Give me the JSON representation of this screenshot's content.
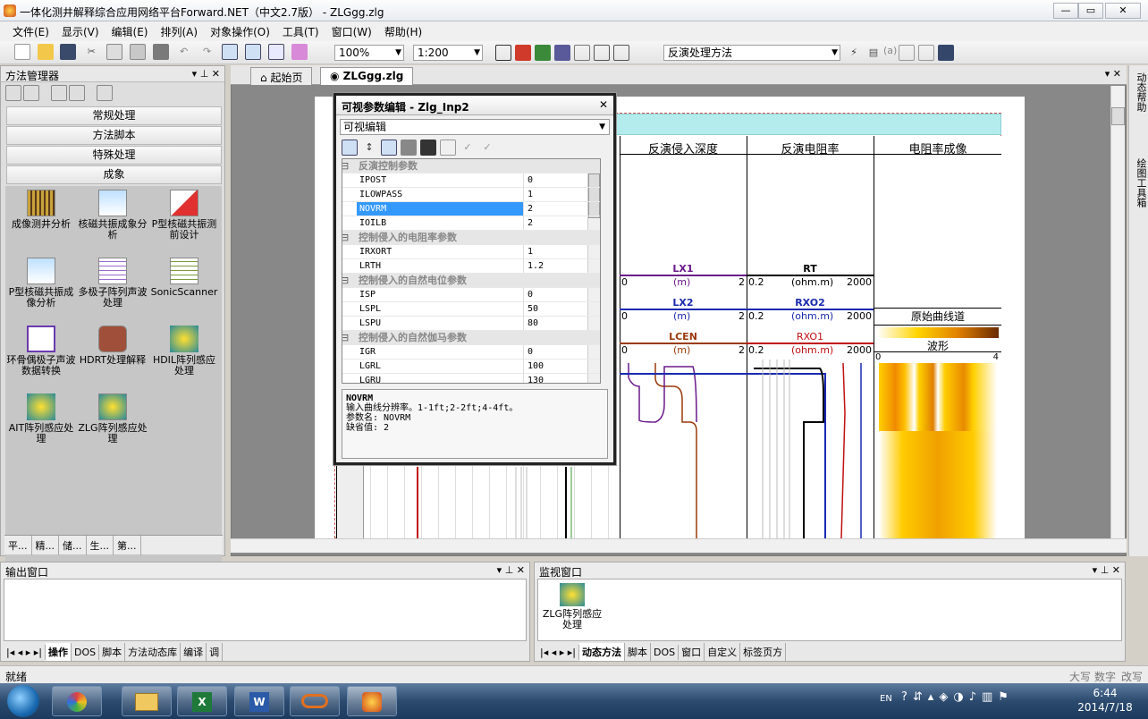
{
  "window": {
    "title": "一体化测井解释综合应用网络平台Forward.NET（中文2.7版） - ZLGgg.zlg",
    "min": "—",
    "restore": "▭",
    "close": "✕"
  },
  "menu": [
    "文件(E)",
    "显示(V)",
    "编辑(E)",
    "排列(A)",
    "对象操作(O)",
    "工具(T)",
    "窗口(W)",
    "帮助(H)"
  ],
  "toolbar": {
    "zoom": "100%",
    "scale": "1:200",
    "method": "反演处理方法",
    "a_label": "(a)"
  },
  "left_panel": {
    "title": "方法管理器",
    "categories": [
      "常规处理",
      "方法脚本",
      "特殊处理",
      "成象"
    ],
    "icons": [
      {
        "label": "成像测井分析",
        "icon": "imaging-log-icon"
      },
      {
        "label": "核磁共振成象分析",
        "icon": "nmr-imaging-icon"
      },
      {
        "label": "P型核磁共振测前设计",
        "icon": "p-nmr-design-icon"
      },
      {
        "label": "P型核磁共振成像分析",
        "icon": "p-nmr-analysis-icon"
      },
      {
        "label": "多极子阵列声波处理",
        "icon": "multipole-acoustic-icon"
      },
      {
        "label": "SonicScanner",
        "icon": "sonic-scanner-icon"
      },
      {
        "label": "环骨偶极子声波数据转换",
        "icon": "dipole-convert-icon"
      },
      {
        "label": "HDRT处理解释",
        "icon": "hdrt-icon"
      },
      {
        "label": "HDIL阵列感应处理",
        "icon": "hdil-icon"
      },
      {
        "label": "AIT阵列感应处理",
        "icon": "ait-icon"
      },
      {
        "label": "ZLG阵列感应处理",
        "icon": "zlg-icon"
      }
    ],
    "bottom_tabs": [
      "平...",
      "精...",
      "储...",
      "生...",
      "第..."
    ]
  },
  "doc_tabs": [
    "起始页",
    "ZLGgg.zlg"
  ],
  "log": {
    "col_headers": [
      "反演侵入深度",
      "反演电阻率",
      "电阻率成像"
    ],
    "curves": [
      {
        "name": "LX1",
        "unit": "(m)",
        "min": "0",
        "max": "2",
        "color": "#6a1a8a"
      },
      {
        "name": "LX2",
        "unit": "(m)",
        "min": "0",
        "max": "2",
        "color": "#1a2ab0"
      },
      {
        "name": "LCEN",
        "unit": "(m)",
        "min": "0",
        "max": "2",
        "color": "#9a3a0a"
      }
    ],
    "rcurves": [
      {
        "name": "RT",
        "unit": "(ohm.m)",
        "min": "0.2",
        "max": "2000",
        "color": "#000000"
      },
      {
        "name": "RXO2",
        "unit": "(ohm.m)",
        "min": "0.2",
        "max": "2000",
        "color": "#1a2ab0"
      },
      {
        "name": "RXO1",
        "unit": "(ohm.m)",
        "min": "0.2",
        "max": "2000",
        "color": "#c01010"
      }
    ],
    "track3": {
      "curve_label": "原始曲线道",
      "wave_label": "波形",
      "min": "0",
      "max": "4"
    }
  },
  "dialog": {
    "title": "可视参数编辑 - Zlg_Inp2",
    "mode": "可视编辑",
    "rows": [
      {
        "type": "cat",
        "k": "反演控制参数"
      },
      {
        "k": "IPOST",
        "v": "0"
      },
      {
        "k": "ILOWPASS",
        "v": "1"
      },
      {
        "k": "NOVRM",
        "v": "2",
        "sel": true
      },
      {
        "k": "IOILB",
        "v": "2"
      },
      {
        "type": "cat",
        "k": "控制侵入的电阻率参数"
      },
      {
        "k": "IRXORT",
        "v": "1"
      },
      {
        "k": "LRTH",
        "v": "1.2"
      },
      {
        "type": "cat",
        "k": "控制侵入的自然电位参数"
      },
      {
        "k": "ISP",
        "v": "0"
      },
      {
        "k": "LSPL",
        "v": "50"
      },
      {
        "k": "LSPU",
        "v": "80"
      },
      {
        "type": "cat",
        "k": "控制侵入的自然伽马参数"
      },
      {
        "k": "IGR",
        "v": "0"
      },
      {
        "k": "LGRL",
        "v": "100"
      },
      {
        "k": "LGRU",
        "v": "130"
      }
    ],
    "help": {
      "name": "NOVRM",
      "desc": "输入曲线分辨率。1-1ft;2-2ft;4-4ft。",
      "param": "参数名: NOVRM",
      "default": "缺省值: 2"
    }
  },
  "right_strip": [
    "动态帮助",
    "绘图工具箱"
  ],
  "output": {
    "title": "输出窗口",
    "tabs": [
      "操作",
      "DOS",
      "脚本",
      "方法动态库",
      "编译",
      "调"
    ]
  },
  "monitor": {
    "title": "监视窗口",
    "item": "ZLG阵列感应处理",
    "tabs": [
      "动态方法",
      "脚本",
      "DOS",
      "窗口",
      "自定义",
      "标签页方"
    ]
  },
  "status": {
    "left": "就绪",
    "caps": "大写",
    "num": "数字",
    "ovr": "改写"
  },
  "taskbar": {
    "lang": "EN",
    "time": "6:44",
    "date": "2014/7/18"
  }
}
